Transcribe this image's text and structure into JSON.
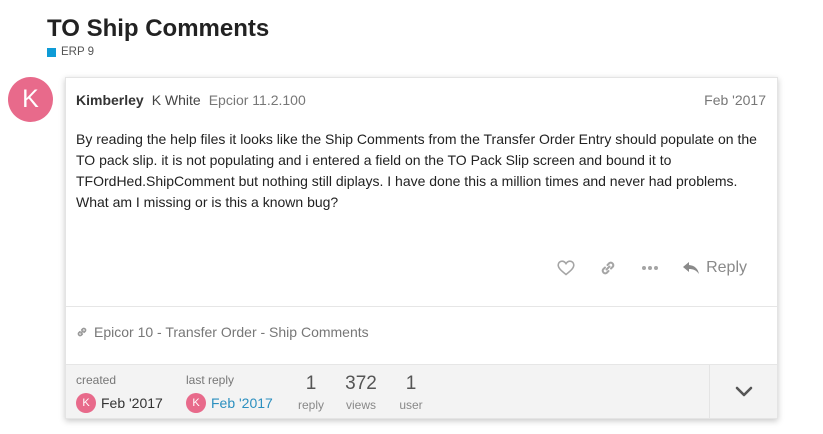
{
  "topic": {
    "title": "TO Ship Comments",
    "category": "ERP 9",
    "category_color": "#0e9bd6"
  },
  "post": {
    "avatar_letter": "K",
    "avatar_color": "#e86a8b",
    "username": "Kimberley",
    "full_name": "K White",
    "user_title": "Epcior 11.2.100",
    "date": "Feb '2017",
    "body": "By reading the help files it looks like the Ship Comments from the Transfer Order Entry should populate on the TO pack slip. it is not populating and i entered a field on the TO Pack Slip screen and bound it to TFOrdHed.ShipComment but nothing still diplays. I have done this a million times and never had problems. What am I missing or is this a known bug?",
    "actions": {
      "like_icon": "heart-icon",
      "link_icon": "link-icon",
      "more_icon": "ellipsis-icon",
      "reply_label": "Reply"
    },
    "linked_topic": "Epicor 10 - Transfer Order - Ship Comments"
  },
  "footer": {
    "created_label": "created",
    "created_avatar": "K",
    "created_date": "Feb '2017",
    "last_reply_label": "last reply",
    "last_reply_avatar": "K",
    "last_reply_date": "Feb '2017",
    "reply_count": "1",
    "reply_label": "reply",
    "views_count": "372",
    "views_label": "views",
    "user_count": "1",
    "user_label": "user"
  }
}
